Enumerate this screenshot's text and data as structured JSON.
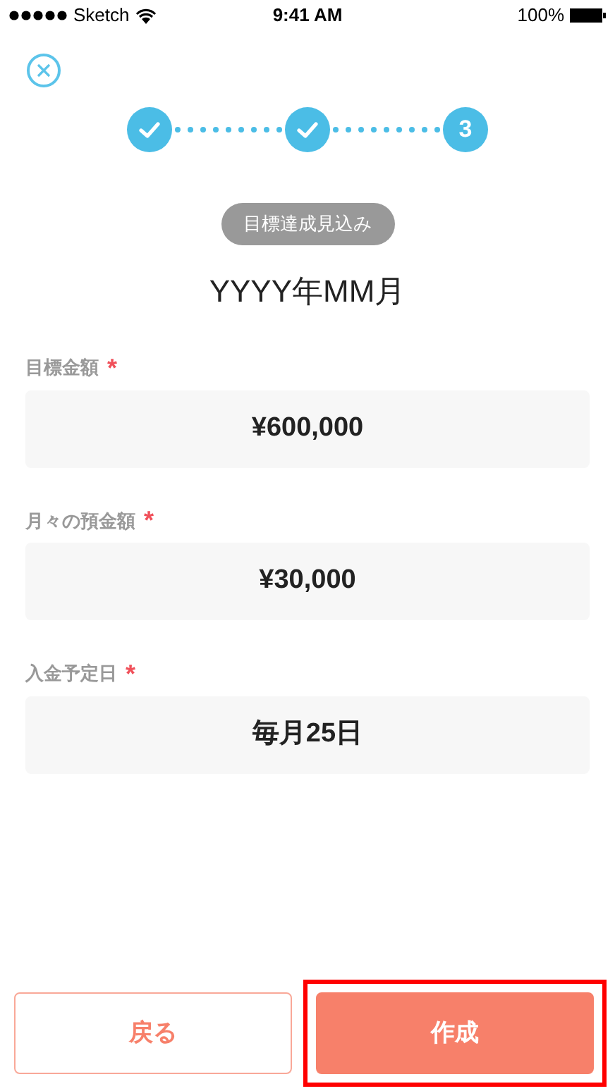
{
  "status_bar": {
    "carrier": "Sketch",
    "time": "9:41 AM",
    "battery": "100%"
  },
  "steps": [
    {
      "kind": "done"
    },
    {
      "kind": "done"
    },
    {
      "kind": "current",
      "label": "3"
    }
  ],
  "badge": "目標達成見込み",
  "title": "YYYY年MM月",
  "fields": [
    {
      "label": "目標金額",
      "required": true,
      "value": "¥600,000"
    },
    {
      "label": "月々の預金額",
      "required": true,
      "value": "¥30,000"
    },
    {
      "label": "入金予定日",
      "required": true,
      "value": "毎月25日"
    }
  ],
  "required_mark": "*",
  "buttons": [
    {
      "label": "戻る",
      "kind": "secondary",
      "highlighted": false
    },
    {
      "label": "作成",
      "kind": "primary",
      "highlighted": true
    }
  ]
}
